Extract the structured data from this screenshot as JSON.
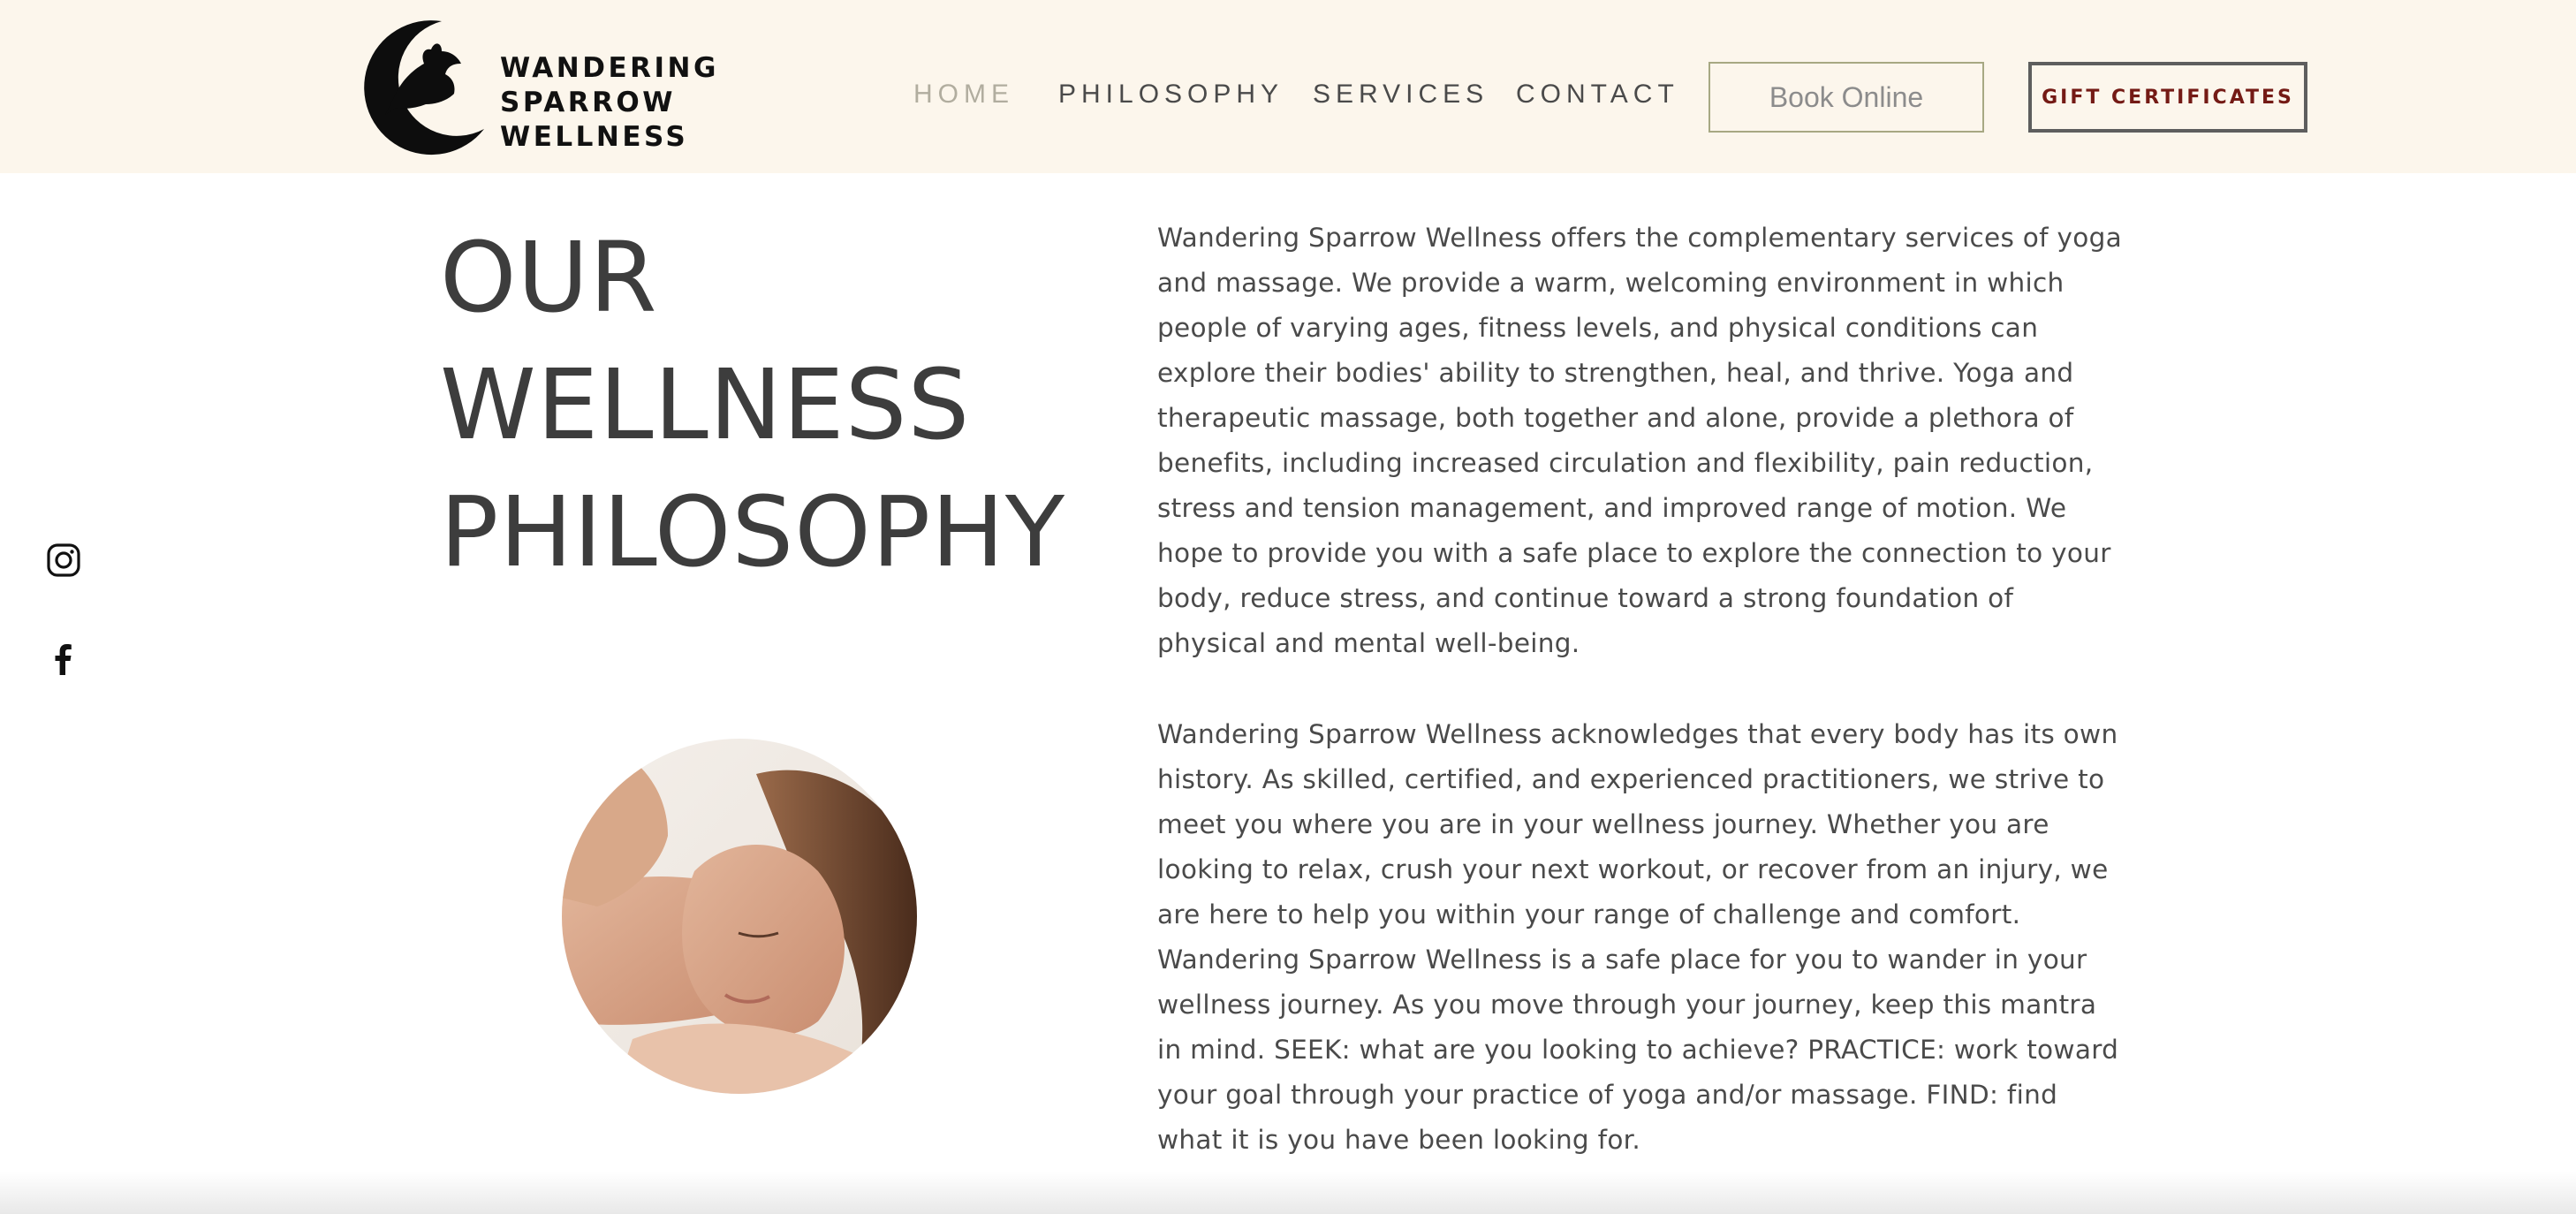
{
  "brand": {
    "line1": "WANDERING",
    "line2": "SPARROW",
    "line3": "WELLNESS"
  },
  "nav": {
    "home": "HOME",
    "philosophy": "PHILOSOPHY",
    "services": "SERVICES",
    "contact": "CONTACT",
    "book_online": "Book Online",
    "gift_certificates": "GIFT CERTIFICATES"
  },
  "social": {
    "icons": [
      "instagram-icon",
      "facebook-icon"
    ]
  },
  "heading": {
    "line1": "OUR",
    "line2": "WELLNESS",
    "line3": "PHILOSOPHY"
  },
  "content": {
    "paragraph1": "Wandering Sparrow Wellness offers the complementary services of yoga and massage. We provide a warm, welcoming environment in which people of varying ages, fitness levels, and physical conditions can explore their bodies' ability to strengthen, heal, and thrive. Yoga and therapeutic massage, both together and alone, provide a plethora of benefits, including increased circulation and flexibility, pain reduction, stress and tension management, and improved range of motion. We hope to provide you with a safe place to explore the connection to your body, reduce stress, and continue toward a strong foundation of physical and mental well-being.",
    "paragraph2": "Wandering Sparrow Wellness acknowledges that every body has its own history. As skilled, certified, and experienced practitioners, we strive to meet you where you are in your wellness journey. Whether you are looking to relax, crush your next workout, or recover from an injury, we are here to help you within your range of challenge and comfort. Wandering Sparrow Wellness is a safe place for you to wander in your wellness journey. As you move through your journey, keep this mantra in mind. SEEK: what are you looking to achieve? PRACTICE: work toward your goal through your practice of yoga and/or massage. FIND: find what it is you have been looking for."
  },
  "colors": {
    "header_bg": "#fcf6ec",
    "nav_active": "#b1ad9f",
    "gift_text": "#741a15"
  }
}
